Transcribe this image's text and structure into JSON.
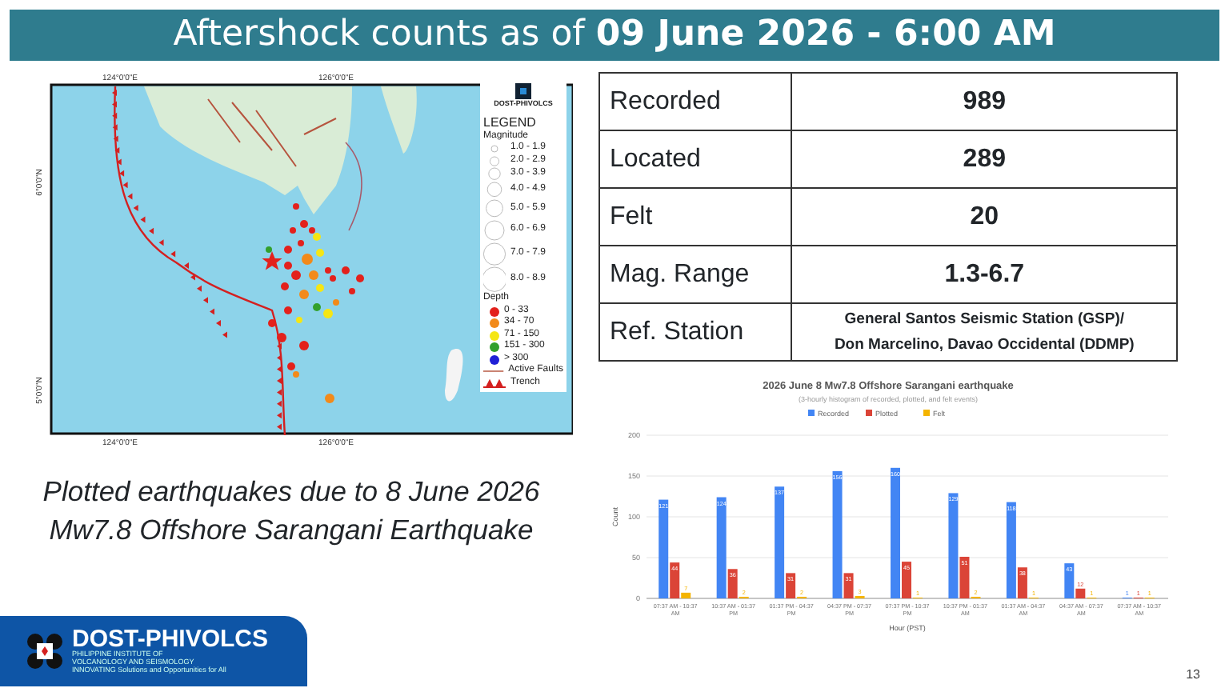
{
  "title": "Aftershock counts as of **09 June 2026 -  6:00 AM**",
  "map": {
    "top_labels": [
      "124°0'0\"E",
      "126°0'0\"E"
    ],
    "bottom_labels": [
      "124°0'0\"E",
      "126°0'0\"E"
    ],
    "left_labels": [
      "6°0'0\"N",
      "5°0'0\"N"
    ],
    "legend": {
      "logo_text": "DOST-PHIVOLCS",
      "title": "LEGEND",
      "magnitude_title": "Magnitude",
      "magnitude_classes": [
        "1.0 - 1.9",
        "2.0 - 2.9",
        "3.0 - 3.9",
        "4.0 - 4.9",
        "5.0 - 5.9",
        "6.0 - 6.9",
        "7.0 - 7.9",
        "8.0 - 8.9"
      ],
      "depth_title": "Depth",
      "depth_classes": [
        {
          "label": "0 - 33",
          "color": "#e3211c"
        },
        {
          "label": "34 - 70",
          "color": "#f28a1a"
        },
        {
          "label": "71 - 150",
          "color": "#f5e614"
        },
        {
          "label": "151 - 300",
          "color": "#33a02c"
        },
        {
          "label": "> 300",
          "color": "#1f1fd6"
        }
      ],
      "lines": [
        {
          "label": "Active Faults",
          "kind": "fault"
        },
        {
          "label": "Trench",
          "kind": "trench"
        }
      ]
    }
  },
  "summary": [
    {
      "label": "Recorded",
      "value": "989"
    },
    {
      "label": "Located",
      "value": "289"
    },
    {
      "label": "Felt",
      "value": "20"
    },
    {
      "label": "Mag. Range",
      "value": "1.3-6.7"
    },
    {
      "label": "Ref. Station",
      "value": "General Santos  Seismic Station (GSP)/\nDon Marcelino, Davao Occidental (DDMP)"
    }
  ],
  "chart_data": {
    "type": "bar",
    "title": "2026 June 8 Mw7.8 Offshore Sarangani earthquake",
    "subtitle": "(3-hourly histogram of recorded, plotted, and felt events)",
    "xlabel": "Hour (PST)",
    "ylabel": "Count",
    "categories": [
      "07:37 AM - 10:37 AM",
      "10:37 AM - 01:37 PM",
      "01:37 PM - 04:37 PM",
      "04:37 PM - 07:37 PM",
      "07:37 PM - 10:37 PM",
      "10:37 PM - 01:37 AM",
      "01:37 AM - 04:37 AM",
      "04:37 AM - 07:37 AM",
      "07:37 AM - 10:37 AM"
    ],
    "series": [
      {
        "name": "Recorded",
        "color": "#4285f4",
        "values": [
          121,
          124,
          137,
          156,
          160,
          129,
          118,
          43,
          1
        ]
      },
      {
        "name": "Plotted",
        "color": "#db4437",
        "values": [
          44,
          36,
          31,
          31,
          45,
          51,
          38,
          12,
          1
        ]
      },
      {
        "name": "Felt",
        "color": "#f4b400",
        "values": [
          7,
          2,
          2,
          3,
          1,
          2,
          1,
          1,
          1
        ]
      }
    ],
    "ylim": [
      0,
      200
    ],
    "yticks": [
      0,
      50,
      100,
      150,
      200
    ],
    "grid": true,
    "legend": true,
    "data_labels": true
  },
  "caption": [
    "Plotted earthquakes due to 8 June 2026",
    "Mw7.8 Offshore Sarangani Earthquake"
  ],
  "footer": {
    "logo_name": "DOST-PHIVOLCS",
    "logo_sub": [
      "PHILIPPINE INSTITUTE OF",
      "VOLCANOLOGY AND SEISMOLOGY",
      "INNOVATING Solutions and Opportunities for All"
    ],
    "page_number": "13"
  }
}
